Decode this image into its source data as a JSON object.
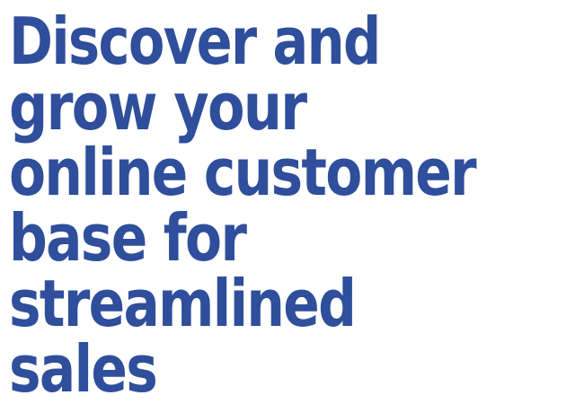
{
  "hero": {
    "headline_lines": [
      "Discover and",
      "grow your",
      "online customer",
      "base for",
      "streamlined",
      "sales"
    ]
  },
  "colors": {
    "headline": "#2f4e9b",
    "background": "#ffffff"
  }
}
